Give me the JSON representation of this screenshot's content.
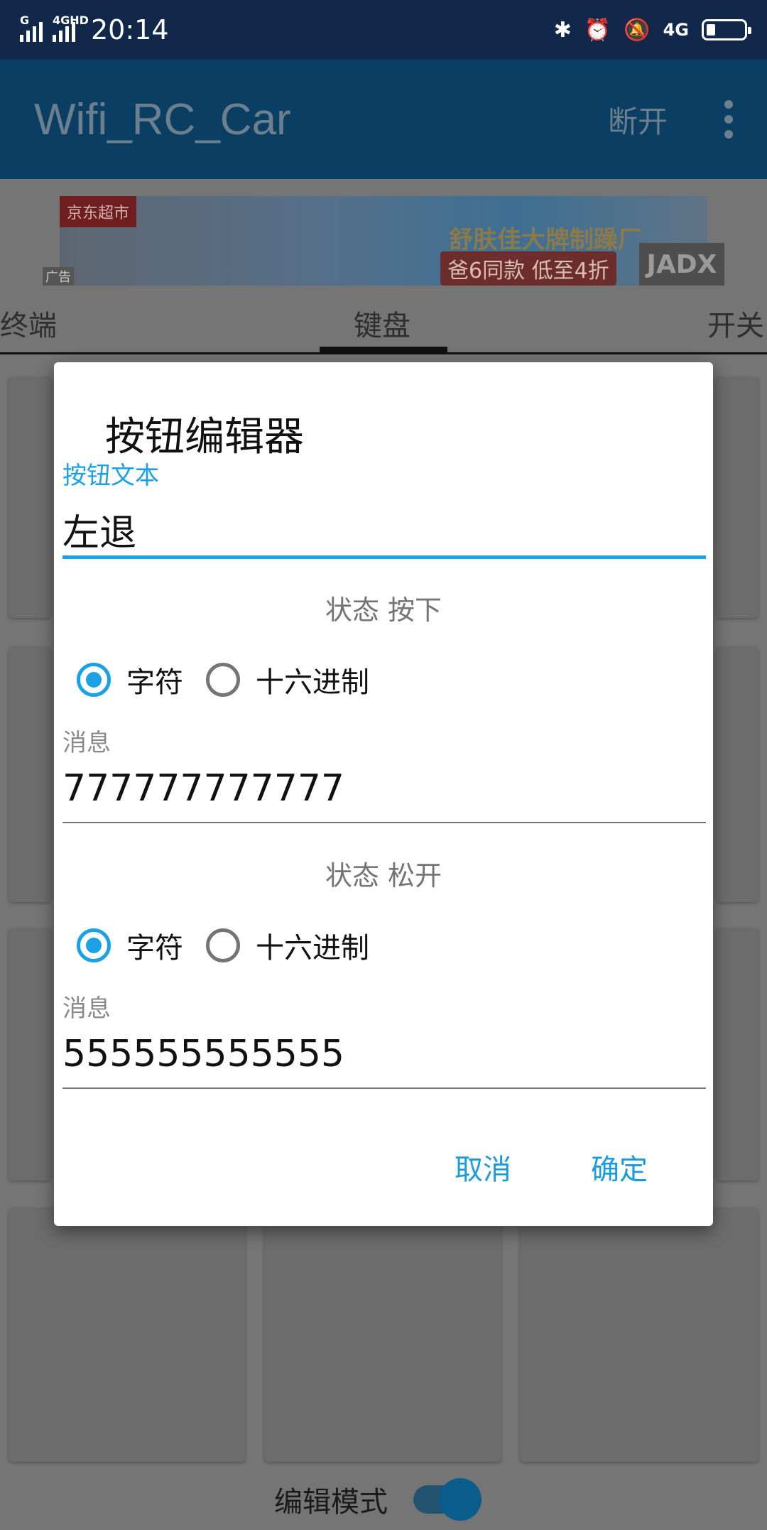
{
  "status_bar": {
    "sim1": "G",
    "sim2": "4GHD",
    "time": "20:14",
    "network": "4G"
  },
  "app_bar": {
    "title": "Wifi_RC_Car",
    "disconnect": "断开"
  },
  "ad": {
    "tag": "京东超市",
    "line1": "舒肤佳大牌制躁厂",
    "line2": "爸6同款 低至4折",
    "corner": "广告",
    "watermark": "JADX"
  },
  "tabs": [
    {
      "label": "终端"
    },
    {
      "label": "键盘"
    },
    {
      "label": "开关"
    }
  ],
  "dialog": {
    "title": "按钮编辑器",
    "button_text_label": "按钮文本",
    "button_text_value": "左退",
    "press": {
      "heading": "状态 按下",
      "options": [
        "字符",
        "十六进制"
      ],
      "selected": "字符",
      "message_label": "消息",
      "message_value": "777777777777"
    },
    "release": {
      "heading": "状态 松开",
      "options": [
        "字符",
        "十六进制"
      ],
      "selected": "字符",
      "message_label": "消息",
      "message_value": "555555555555"
    },
    "cancel": "取消",
    "confirm": "确定"
  },
  "bottom": {
    "edit_mode_label": "编辑模式",
    "edit_mode_on": true
  },
  "colors": {
    "accent": "#1aa1e6",
    "app_bar_dimmed": "#0b3e63",
    "status_bar": "#11284a"
  }
}
